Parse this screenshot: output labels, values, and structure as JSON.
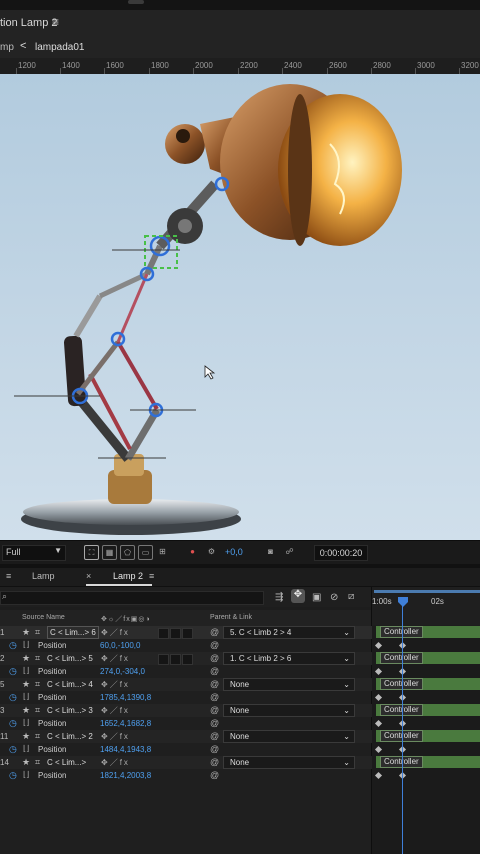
{
  "comp": {
    "title": "tion Lamp 2",
    "menu_icon": "hamburger-menu-icon",
    "breadcrumb_prev": "mp",
    "breadcrumb_current": "lampada01"
  },
  "ruler": [
    "1200",
    "1400",
    "1600",
    "1800",
    "2000",
    "2200",
    "2400",
    "2600",
    "2800",
    "3000",
    "3200"
  ],
  "viewer_toolbar": {
    "resolution": "Full",
    "exposure": "+0,0",
    "timecode": "0:00:00:20"
  },
  "timeline": {
    "tabs": [
      "Lamp",
      "Lamp 2"
    ],
    "close_glyph": "×",
    "search_icon": "search-icon",
    "headers": {
      "source_name": "Source Name",
      "parent_link": "Parent & Link",
      "switches": "switch-icons"
    },
    "time_labels": [
      "1:00s",
      "02s"
    ],
    "layers": [
      {
        "num": "1",
        "name": "C < Lim...> 6",
        "parent": "5. C < Limb 2 > 4",
        "prop": "Position",
        "value": "60,0,-100,0",
        "controller": "Controller"
      },
      {
        "num": "2",
        "name": "C < Lim...> 5",
        "parent": "1. C < Limb 2 > 6",
        "prop": "Position",
        "value": "274,0,-304,0",
        "controller": "Controller"
      },
      {
        "num": "5",
        "name": "C < Lim...> 4",
        "parent": "None",
        "prop": "Position",
        "value": "1785,4,1390,8",
        "controller": "Controller"
      },
      {
        "num": "3",
        "name": "C < Lim...> 3",
        "parent": "None",
        "prop": "Position",
        "value": "1652,4,1682,8",
        "controller": "Controller"
      },
      {
        "num": "11",
        "name": "C < Lim...> 2",
        "parent": "None",
        "prop": "Position",
        "value": "1484,4,1943,8",
        "controller": "Controller"
      },
      {
        "num": "14",
        "name": "C < Lim...>",
        "parent": "None",
        "prop": "Position",
        "value": "1821,4,2003,8",
        "controller": "Controller"
      }
    ]
  },
  "colors": {
    "accent_blue": "#4fa0f0",
    "track_green": "#4a7a3e",
    "panel_bg": "#1f1f1f",
    "viewer_bg": "#c3d6e5"
  }
}
